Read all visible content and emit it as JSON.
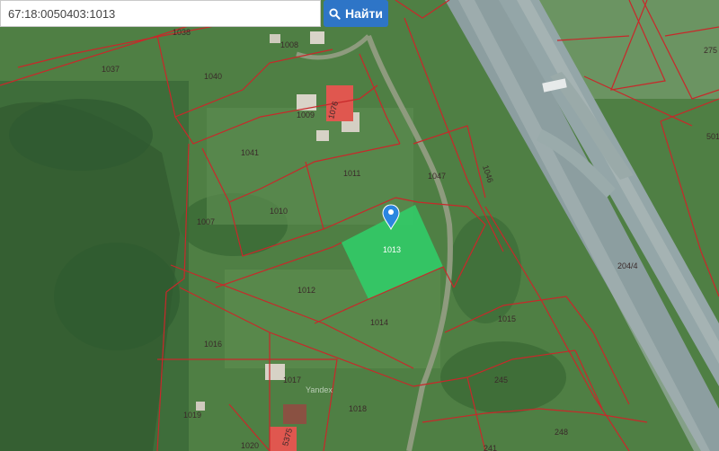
{
  "search": {
    "value": "67:18:0050403:1013",
    "button_label": "Найти"
  },
  "map": {
    "selected_parcel": "1013",
    "watermark": "Yandex",
    "parcels": [
      "1038",
      "1008",
      "1037",
      "1040",
      "275",
      "1009",
      "1076",
      "1041",
      "1011",
      "1047",
      "1046",
      "501",
      "1007",
      "1010",
      "1013",
      "204/4",
      "1012",
      "1014",
      "1015",
      "1016",
      "1017",
      "245",
      "1019",
      "1018",
      "248",
      "1020",
      "5375",
      "241"
    ],
    "colors": {
      "boundary": "#c8282a",
      "selected_fill": "#2fd06a",
      "marker": "#2b86e0",
      "road": "#8fa3a6",
      "building_red": "#e0574f"
    }
  }
}
